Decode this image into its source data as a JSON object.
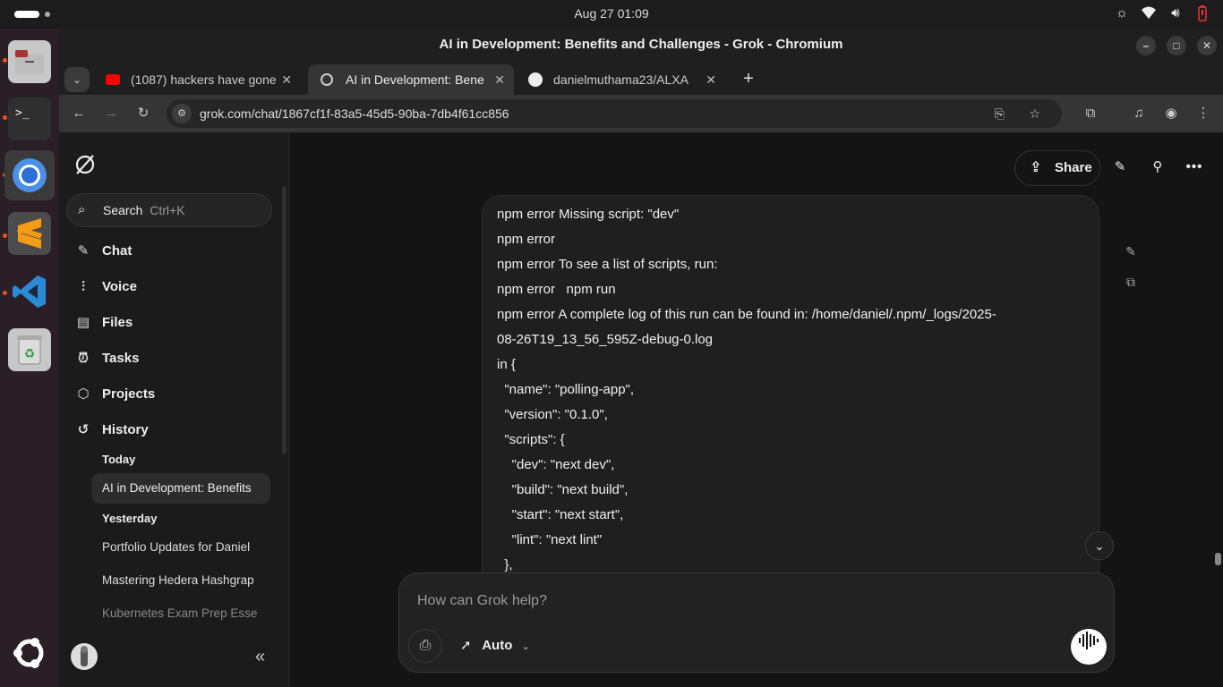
{
  "system": {
    "clock": "Aug 27  01:09"
  },
  "window": {
    "title": "AI in Development: Benefits and Challenges - Grok - Chromium"
  },
  "tabs": [
    {
      "title": "(1087) hackers have gone"
    },
    {
      "title": "AI in Development: Bene"
    },
    {
      "title": "danielmuthama23/ALXA"
    }
  ],
  "omnibox": {
    "url": "grok.com/chat/1867cf1f-83a5-45d5-90ba-7db4f61cc856"
  },
  "sidebar": {
    "search_label": "Search",
    "search_shortcut": "Ctrl+K",
    "nav": [
      "Chat",
      "Voice",
      "Files",
      "Tasks",
      "Projects",
      "History"
    ],
    "history": {
      "today_label": "Today",
      "today": [
        "AI in Development: Benefits"
      ],
      "yesterday_label": "Yesterday",
      "yesterday": [
        "Portfolio Updates for Daniel",
        "Mastering Hedera Hashgrap",
        "Kubernetes Exam Prep Esse"
      ]
    }
  },
  "header": {
    "share_label": "Share"
  },
  "message": {
    "lines": [
      "npm error Missing script: \"dev\"",
      "npm error",
      "npm error To see a list of scripts, run:",
      "npm error   npm run",
      "npm error A complete log of this run can be found in: /home/daniel/.npm/_logs/2025-",
      "08-26T19_13_56_595Z-debug-0.log",
      "in {",
      "  \"name\": \"polling-app\",",
      "  \"version\": \"0.1.0\",",
      "  \"scripts\": {",
      "    \"dev\": \"next dev\",",
      "    \"build\": \"next build\",",
      "    \"start\": \"next start\",",
      "    \"lint\": \"next lint\"",
      "  },"
    ]
  },
  "composer": {
    "placeholder": "How can Grok help?",
    "model_label": "Auto"
  },
  "colors": {
    "accent_red": "#ff0000",
    "page_bg": "#141414",
    "sidebar_bg": "#1b1b1b"
  }
}
